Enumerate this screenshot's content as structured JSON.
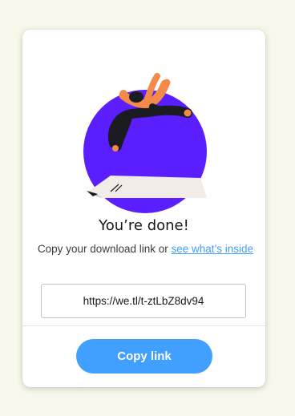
{
  "colors": {
    "background": "#f7f8ea",
    "card": "#ffffff",
    "accent": "#409fff",
    "illustration_circle": "#5b1eff",
    "illustration_figure_skin": "#f28a4a",
    "illustration_figure_body": "#1b1b22"
  },
  "illustration": {
    "icon": "person-jumping-on-mat-illustration"
  },
  "dialog": {
    "title": "You’re done!",
    "subtitle_prefix": "Copy your download link or ",
    "subtitle_link": "see what’s inside",
    "link_value": "https://we.tl/t-ztLbZ8dv94",
    "copy_button_label": "Copy link"
  }
}
